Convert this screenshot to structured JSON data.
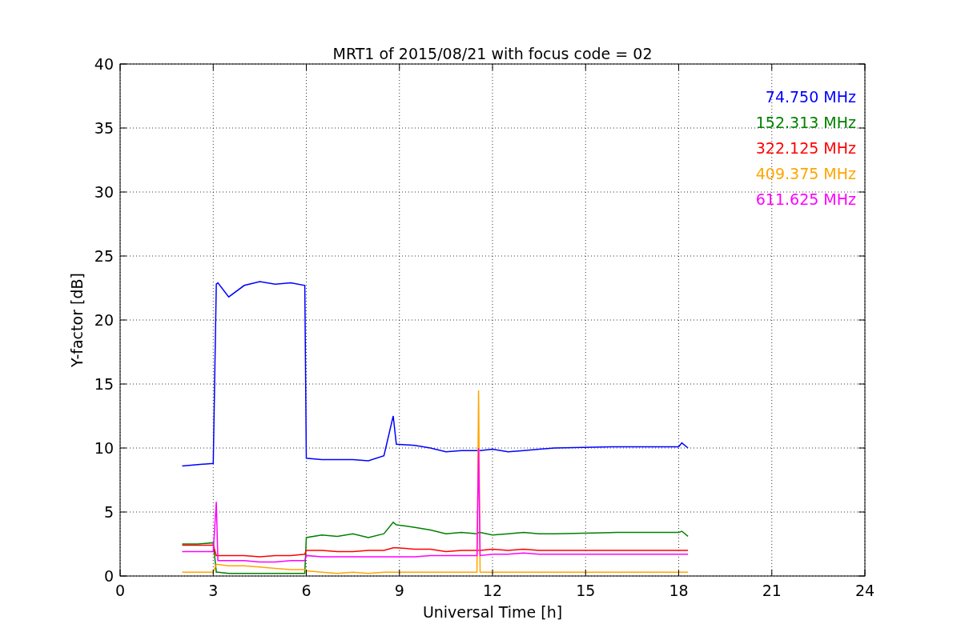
{
  "figure": {
    "chart_data": {
      "type": "line",
      "title": "MRT1 of 2015/08/21 with focus code = 02",
      "xlabel": "Universal Time [h]",
      "ylabel": "Y-factor [dB]",
      "x": [
        2,
        2.5,
        3,
        3.1,
        3.15,
        3.5,
        4,
        4.5,
        5,
        5.5,
        5.95,
        6.0,
        6.5,
        7,
        7.5,
        8,
        8.5,
        8.8,
        8.9,
        9.5,
        10,
        10.5,
        11,
        11.5,
        11.55,
        11.6,
        12,
        12.5,
        13,
        13.5,
        14,
        16,
        18,
        18.1,
        18.3
      ],
      "series": [
        {
          "name": "74.750 MHz",
          "color": "#0000ff",
          "values": [
            8.6,
            8.7,
            8.8,
            22.8,
            22.9,
            21.8,
            22.7,
            23.0,
            22.8,
            22.9,
            22.7,
            9.2,
            9.1,
            9.1,
            9.1,
            9.0,
            9.4,
            12.5,
            10.3,
            10.2,
            10.0,
            9.7,
            9.8,
            9.8,
            9.8,
            9.8,
            9.9,
            9.7,
            9.8,
            9.9,
            10.0,
            10.1,
            10.1,
            10.4,
            10.0
          ]
        },
        {
          "name": "152.313 MHz",
          "color": "#008000",
          "values": [
            2.5,
            2.5,
            2.6,
            0.3,
            0.3,
            0.2,
            0.2,
            0.2,
            0.2,
            0.2,
            0.2,
            3.0,
            3.2,
            3.1,
            3.3,
            3.0,
            3.3,
            4.2,
            4.0,
            3.8,
            3.6,
            3.3,
            3.4,
            3.3,
            3.4,
            3.4,
            3.2,
            3.3,
            3.4,
            3.3,
            3.3,
            3.4,
            3.4,
            3.5,
            3.1
          ]
        },
        {
          "name": "322.125 MHz",
          "color": "#ff0000",
          "values": [
            2.4,
            2.4,
            2.4,
            1.6,
            1.6,
            1.6,
            1.6,
            1.5,
            1.6,
            1.6,
            1.7,
            2.0,
            2.0,
            1.9,
            1.9,
            2.0,
            2.0,
            2.2,
            2.2,
            2.1,
            2.1,
            1.9,
            2.0,
            2.0,
            2.0,
            2.0,
            2.1,
            2.0,
            2.1,
            2.0,
            2.0,
            2.0,
            2.0,
            2.0,
            2.0
          ]
        },
        {
          "name": "409.375 MHz",
          "color": "#ffa500",
          "values": [
            0.3,
            0.3,
            0.3,
            0.9,
            0.9,
            0.8,
            0.8,
            0.7,
            0.6,
            0.5,
            0.5,
            0.4,
            0.3,
            0.2,
            0.3,
            0.2,
            0.3,
            0.3,
            0.3,
            0.3,
            0.3,
            0.3,
            0.3,
            0.3,
            14.5,
            0.3,
            0.3,
            0.3,
            0.3,
            0.3,
            0.3,
            0.3,
            0.3,
            0.3,
            0.3
          ]
        },
        {
          "name": "611.625 MHz",
          "color": "#ff00ff",
          "values": [
            1.9,
            1.9,
            1.9,
            5.8,
            1.2,
            1.2,
            1.2,
            1.1,
            1.1,
            1.2,
            1.2,
            1.6,
            1.5,
            1.5,
            1.5,
            1.5,
            1.5,
            1.5,
            1.5,
            1.5,
            1.6,
            1.6,
            1.6,
            1.6,
            10.0,
            1.6,
            1.7,
            1.7,
            1.8,
            1.7,
            1.7,
            1.7,
            1.7,
            1.7,
            1.7
          ]
        }
      ],
      "grid": true,
      "xlim": [
        0,
        24
      ],
      "ylim": [
        0,
        40
      ],
      "xticks": [
        0,
        3,
        6,
        9,
        12,
        15,
        18,
        21,
        24
      ],
      "yticks": [
        0,
        5,
        10,
        15,
        20,
        25,
        30,
        35,
        40
      ]
    }
  }
}
